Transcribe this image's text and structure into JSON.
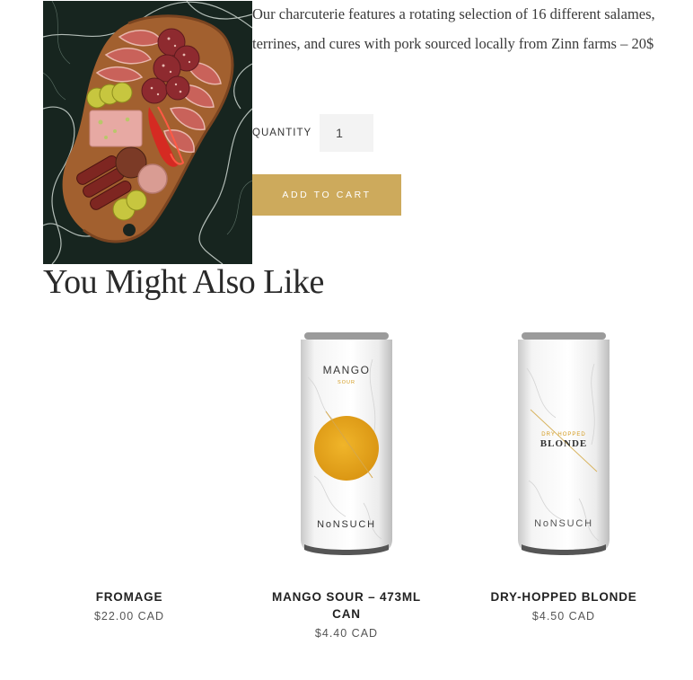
{
  "product": {
    "image_alt": "Charcuterie board",
    "description": "Our charcuterie features a rotating selection of 16 different salames, terrines, and cures with pork sourced locally from Zinn farms – 20$",
    "quantity_label": "QUANTITY",
    "quantity_value": "1",
    "add_to_cart_label": "ADD TO CART",
    "accent_color": "#cdaa5c"
  },
  "related": {
    "title": "You Might Also Like",
    "items": [
      {
        "name": "FROMAGE",
        "price": "$22.00 CAD",
        "image": "none"
      },
      {
        "name": "MANGO SOUR – 473ML CAN",
        "price": "$4.40 CAD",
        "image": "can-mango-sour",
        "can_text": {
          "line1": "MANGO",
          "line2": "SOUR",
          "brand": "NoNSUCH"
        }
      },
      {
        "name": "DRY-HOPPED BLONDE",
        "price": "$4.50 CAD",
        "image": "can-blonde",
        "can_text": {
          "line1": "DRY HOPPED",
          "line2": "BLONDE",
          "brand": "NoNSUCH"
        }
      }
    ]
  }
}
